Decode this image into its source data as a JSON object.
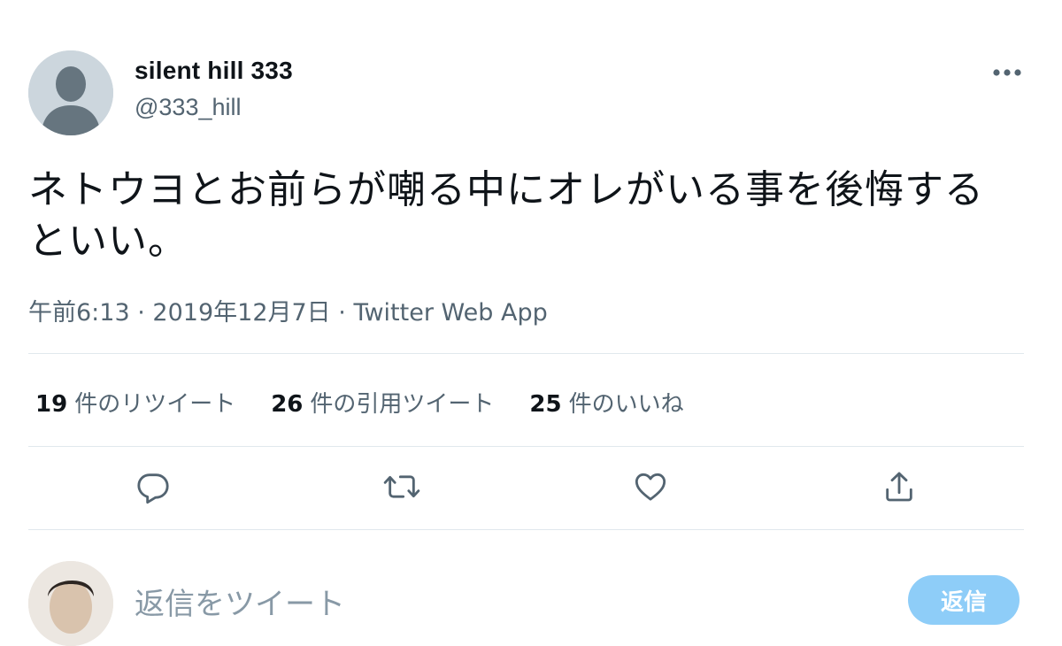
{
  "author": {
    "name": "silent hill 333",
    "handle": "@333_hill"
  },
  "tweet": {
    "text": "ネトウヨとお前らが嘲る中にオレがいる事を後悔するといい。",
    "time": "午前6:13",
    "date": "2019年12月7日",
    "source": "Twitter Web App",
    "separator": "·"
  },
  "stats": {
    "retweets_count": "19",
    "retweets_label": "件のリツイート",
    "quotes_count": "26",
    "quotes_label": "件の引用ツイート",
    "likes_count": "25",
    "likes_label": "件のいいね"
  },
  "actions": {
    "icons": [
      "reply-icon",
      "retweet-icon",
      "like-icon",
      "share-icon"
    ]
  },
  "reply": {
    "placeholder": "返信をツイート",
    "button_label": "返信"
  },
  "colors": {
    "secondary_text": "#536471",
    "divider": "#e1e8ed",
    "reply_button": "#8ecdf8"
  }
}
